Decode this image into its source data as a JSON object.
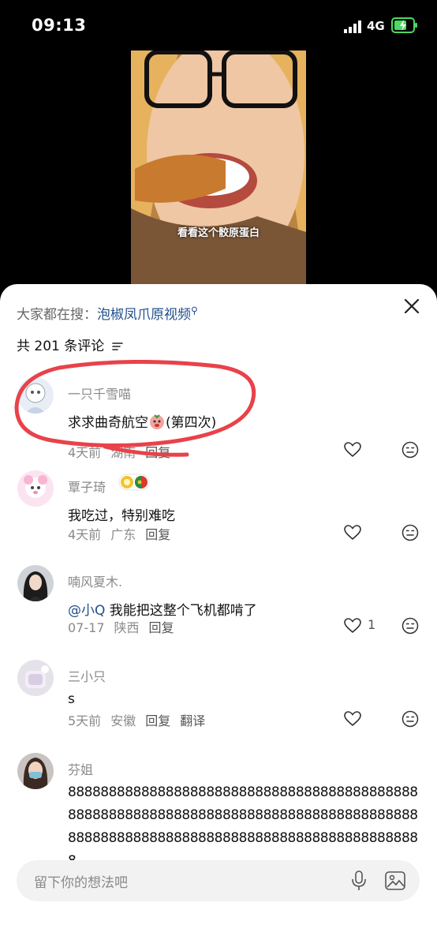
{
  "status_bar": {
    "time": "09:13",
    "network": "4G"
  },
  "video": {
    "caption": "看看这个骹原蛋白"
  },
  "search": {
    "prefix": "大家都在搜：",
    "term": "泡椒凤爪原视频"
  },
  "comments_header": {
    "count_label": "共 201 条评论"
  },
  "comments": [
    {
      "username": "一只千雪喵",
      "text_before": "求求曲奇航空",
      "text_after": "(第四次)",
      "time": "4天前",
      "location": "湖南",
      "reply": "回复"
    },
    {
      "username": "覃子琦",
      "text": "我吃过，特别难吃",
      "time": "4天前",
      "location": "广东",
      "reply": "回复"
    },
    {
      "username": "喃风夏木.",
      "mention": "@小Q",
      "text": " 我能把这整个飞机都啃了",
      "time": "07-17",
      "location": "陕西",
      "reply": "回复",
      "likes": "1"
    },
    {
      "username": "三小只",
      "text": "s",
      "time": "5天前",
      "location": "安徽",
      "reply": "回复",
      "translate": "翻译"
    },
    {
      "username": "芬姐",
      "text": "8888888888888888888888888888888888888888888888888888888888888888888888888888888888888888888888888888888888888888888888888888888888"
    }
  ],
  "input": {
    "placeholder": "留下你的想法吧"
  },
  "colors": {
    "annotation_red": "#e8424a",
    "link_blue": "#1f4f8a"
  },
  "icons": [
    "close-icon",
    "filter-icon",
    "heart-icon",
    "smile-icon",
    "mic-icon",
    "image-icon",
    "search-icon"
  ]
}
